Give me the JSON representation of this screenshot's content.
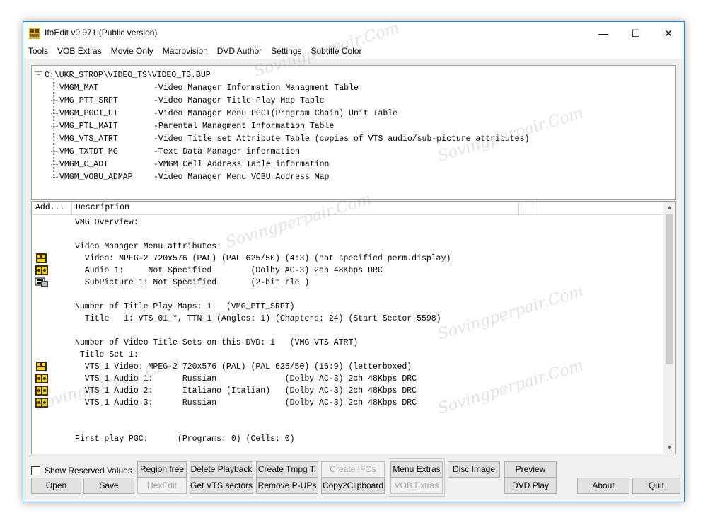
{
  "window": {
    "title": "IfoEdit v0.971 (Public version)",
    "controls": {
      "minimize": "—",
      "maximize": "☐",
      "close": "✕"
    }
  },
  "menu": [
    "Tools",
    "VOB Extras",
    "Movie Only",
    "Macrovision",
    "DVD Author",
    "Settings",
    "Subtitle Color"
  ],
  "tree": {
    "root": "C:\\UKR_STROP\\VIDEO_TS\\VIDEO_TS.BUP",
    "expander": "−",
    "items": [
      {
        "name": "VMGM_MAT",
        "desc": "-Video Manager Information Managment Table"
      },
      {
        "name": "VMG_PTT_SRPT",
        "desc": "-Video Manager Title Play Map Table"
      },
      {
        "name": "VMGM_PGCI_UT",
        "desc": "-Video Manager Menu PGCI(Program Chain) Unit Table"
      },
      {
        "name": "VMG_PTL_MAIT",
        "desc": "-Parental Managment Information Table"
      },
      {
        "name": "VMG_VTS_ATRT",
        "desc": "-Video Title set Attribute Table (copies of VTS audio/sub-picture attributes)"
      },
      {
        "name": "VMG_TXTDT_MG",
        "desc": "-Text Data Manager information"
      },
      {
        "name": "VMGM_C_ADT",
        "desc": "-VMGM Cell Address Table information"
      },
      {
        "name": "VMGM_VOBU_ADMAP",
        "desc": "-Video Manager Menu VOBU Address Map"
      }
    ]
  },
  "list": {
    "headers": [
      "Add...",
      "Description"
    ],
    "lines": [
      {
        "text": "VMG Overview:",
        "icon": ""
      },
      {
        "text": "",
        "icon": ""
      },
      {
        "text": "Video Manager Menu attributes:",
        "icon": ""
      },
      {
        "text": "  Video: MPEG-2 720x576 (PAL) (PAL 625/50) (4:3) (not specified perm.display)",
        "icon": "film-icon"
      },
      {
        "text": "  Audio 1:     Not Specified        (Dolby AC-3) 2ch 48Kbps DRC",
        "icon": "audio-icon"
      },
      {
        "text": "  SubPicture 1: Not Specified       (2-bit rle )",
        "icon": "subpicture-icon"
      },
      {
        "text": "",
        "icon": ""
      },
      {
        "text": "Number of Title Play Maps: 1   (VMG_PTT_SRPT)",
        "icon": ""
      },
      {
        "text": "  Title   1: VTS_01_*, TTN_1 (Angles: 1) (Chapters: 24) (Start Sector 5598)",
        "icon": ""
      },
      {
        "text": "",
        "icon": ""
      },
      {
        "text": "Number of Video Title Sets on this DVD: 1   (VMG_VTS_ATRT)",
        "icon": ""
      },
      {
        "text": " Title Set 1:",
        "icon": ""
      },
      {
        "text": "  VTS_1 Video: MPEG-2 720x576 (PAL) (PAL 625/50) (16:9) (letterboxed)",
        "icon": "film-icon"
      },
      {
        "text": "  VTS_1 Audio 1:      Russian              (Dolby AC-3) 2ch 48Kbps DRC",
        "icon": "audio-icon"
      },
      {
        "text": "  VTS_1 Audio 2:      Italiano (Italian)   (Dolby AC-3) 2ch 48Kbps DRC",
        "icon": "audio-icon"
      },
      {
        "text": "  VTS_1 Audio 3:      Russian              (Dolby AC-3) 2ch 48Kbps DRC",
        "icon": "audio-icon"
      },
      {
        "text": "",
        "icon": ""
      },
      {
        "text": "",
        "icon": ""
      },
      {
        "text": "First play PGC:      (Programs: 0) (Cells: 0)",
        "icon": ""
      }
    ],
    "scroll_up": "▲",
    "scroll_down": "▼"
  },
  "bottom": {
    "show_reserved": "Show Reserved Values",
    "buttons": {
      "region_free": "Region free",
      "delete_playback": "Delete Playback",
      "create_tmpg": "Create Tmpg T.",
      "create_ifos": "Create IFOs",
      "menu_extras": "Menu Extras",
      "disc_image": "Disc Image",
      "preview": "Preview",
      "open": "Open",
      "save": "Save",
      "hexedit": "HexEdit",
      "get_vts": "Get VTS sectors",
      "remove_pups": "Remove P-UPs",
      "copy2clip": "Copy2Clipboard",
      "vob_extras": "VOB Extras",
      "dvd_play": "DVD Play",
      "about": "About",
      "quit": "Quit"
    }
  },
  "watermark": "Sovingperpair.Com",
  "colors": {
    "accent": "#1883d7",
    "icon_yellow": "#f2d21e",
    "icon_dark": "#3a2a10"
  }
}
